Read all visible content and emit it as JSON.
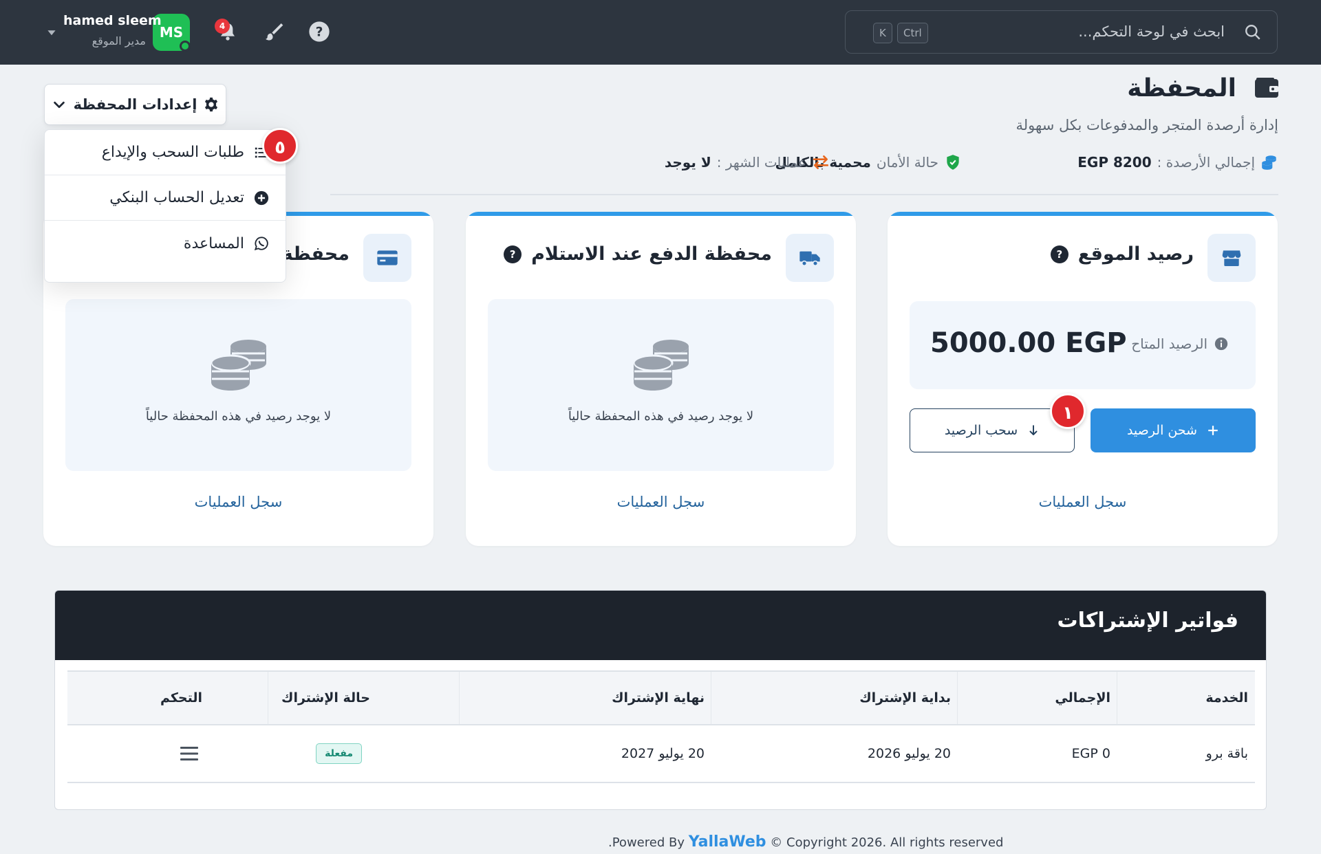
{
  "topbar": {
    "search_placeholder": "ابحث في لوحة التحكم...",
    "kbd_ctrl": "Ctrl",
    "kbd_k": "K",
    "notifications_count": "4",
    "user": {
      "name": "hamed sleem",
      "role": "مدير الموقع",
      "initials": "MS"
    }
  },
  "page": {
    "title": "المحفظة",
    "subtitle": "إدارة أرصدة المتجر والمدفوعات بكل سهولة",
    "stats": {
      "total_label": "إجمالي الأرصدة :",
      "total_value": "EGP 8200",
      "security_label": "حالة الأمان",
      "security_value": "محمية بالكامل",
      "month_label": "عمليات الشهر :",
      "month_value": "لا يوجد"
    }
  },
  "settings": {
    "button_label": "إعدادات المحفظة",
    "menu": [
      {
        "label": "طلبات السحب والإيداع"
      },
      {
        "label": "تعديل الحساب البنكي"
      },
      {
        "label": "المساعدة"
      }
    ],
    "badge": "٥"
  },
  "cards": {
    "site": {
      "title": "رصيد الموقع",
      "balance_label": "الرصيد المتاح",
      "balance_value": "5000.00 EGP",
      "charge_label": "شحن الرصيد",
      "withdraw_label": "سحب الرصيد",
      "ops_link": "سجل العمليات",
      "badge": "١"
    },
    "cod": {
      "title": "محفظة الدفع عند الاستلام",
      "empty_text": "لا يوجد رصيد في هذه المحفظة حالياً",
      "ops_link": "سجل العمليات"
    },
    "third": {
      "title": "محفظة",
      "empty_text": "لا يوجد رصيد في هذه المحفظة حالياً",
      "ops_link": "سجل العمليات"
    }
  },
  "invoices": {
    "title": "فواتير الإشتراكات",
    "columns": [
      "الخدمة",
      "الإجمالي",
      "بداية الإشتراك",
      "نهاية الإشتراك",
      "حالة الإشتراك",
      "التحكم"
    ],
    "rows": [
      {
        "service": "باقة برو",
        "total": "EGP 0",
        "start": "20 يوليو 2026",
        "end": "20 يوليو 2027",
        "status": "مفعلة"
      }
    ]
  },
  "footer": {
    "powered": ".Powered By",
    "brand": "YallaWeb",
    "copyright": "© Copyright 2026. All rights reserved"
  },
  "colors": {
    "accent": "#2f8fe0",
    "topbar": "#2d353f",
    "danger": "#e0282d",
    "success": "#1fbf55"
  }
}
